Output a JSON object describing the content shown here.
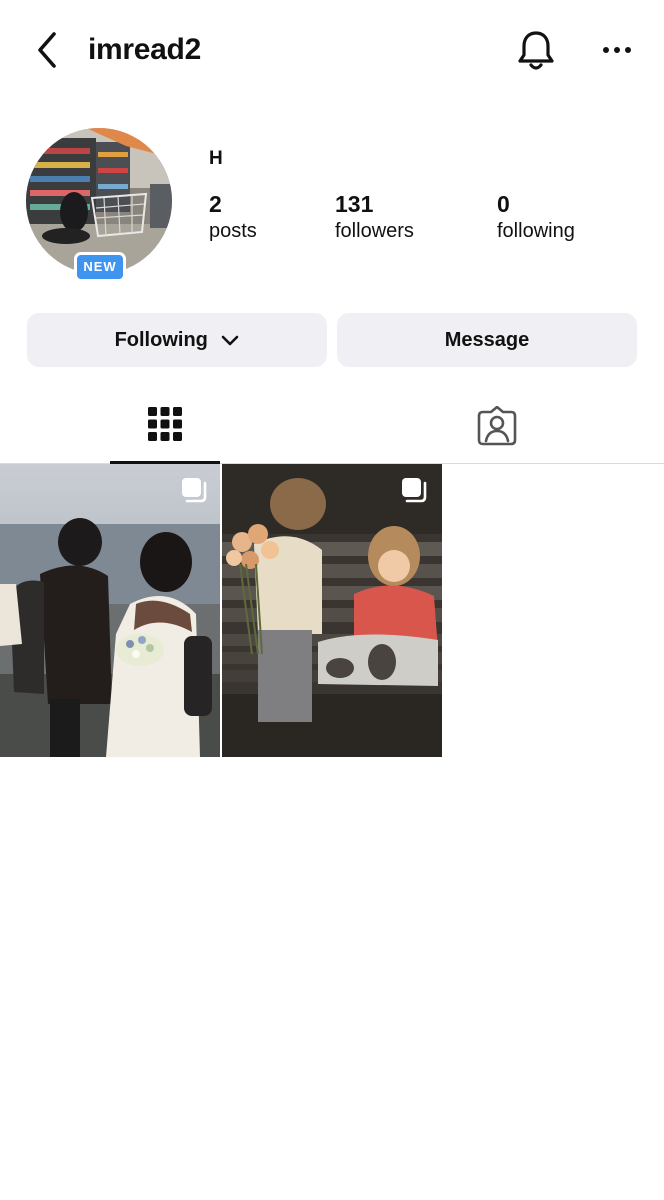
{
  "header": {
    "username": "imread2"
  },
  "profile": {
    "display_name": "H",
    "badge": "NEW",
    "stats": [
      {
        "value": "2",
        "label": "posts"
      },
      {
        "value": "131",
        "label": "followers"
      },
      {
        "value": "0",
        "label": "following"
      }
    ]
  },
  "actions": {
    "following_label": "Following",
    "message_label": "Message"
  },
  "icons": {
    "back": "chevron-left-icon",
    "bell": "bell-icon",
    "more": "more-horizontal-icon",
    "grid": "grid-icon",
    "tagged": "tagged-person-icon",
    "multi": "carousel-icon"
  },
  "colors": {
    "accent": "#3f94f0",
    "button_bg": "#efeff4"
  }
}
